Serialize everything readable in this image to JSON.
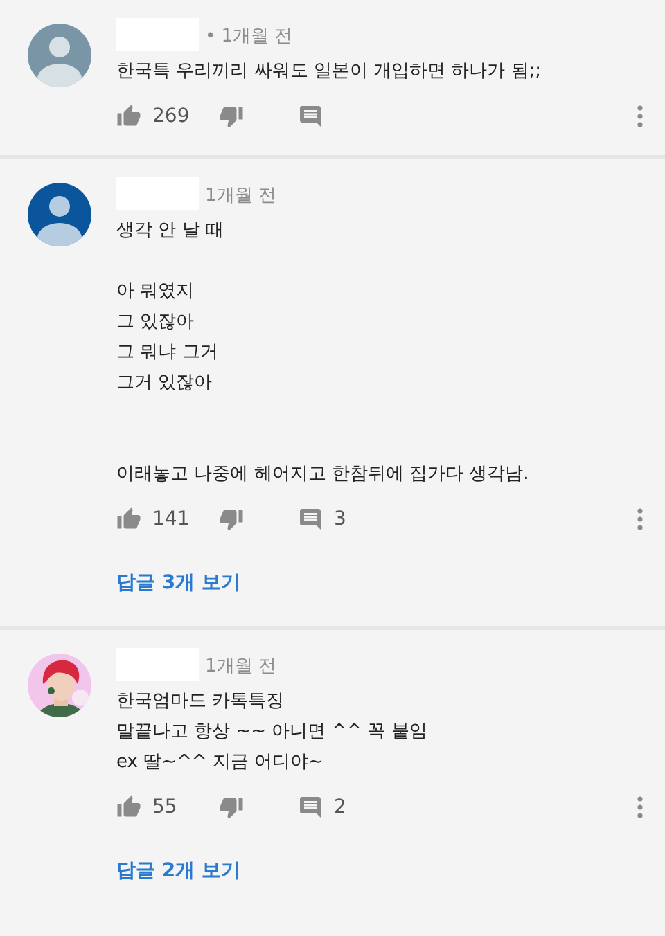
{
  "comments": [
    {
      "avatar": {
        "kind": "default",
        "color": "#7a96a6"
      },
      "time": "• 1개월 전",
      "text": "한국특 우리끼리 싸워도 일본이 개입하면 하나가 됨;;",
      "likes": "269"
    },
    {
      "avatar": {
        "kind": "default",
        "color": "#0b559c"
      },
      "time": "1개월 전",
      "text": "생각 안 날 때\n\n아 뭐였지\n그 있잖아\n그 뭐냐 그거\n그거 있잖아\n\n\n이래놓고 나중에 헤어지고 한참뒤에 집가다 생각남.",
      "likes": "141",
      "reply_count": "3",
      "replies_link": "답글 3개 보기"
    },
    {
      "time": "1개월 전",
      "text": "한국엄마드 카톡특징\n말끝나고 항상 ~~ 아니면 ^^ 꼭 붙임\nex  딸~^^ 지금 어디야~",
      "likes": "55",
      "reply_count": "2",
      "replies_link": "답글 2개 보기"
    }
  ]
}
